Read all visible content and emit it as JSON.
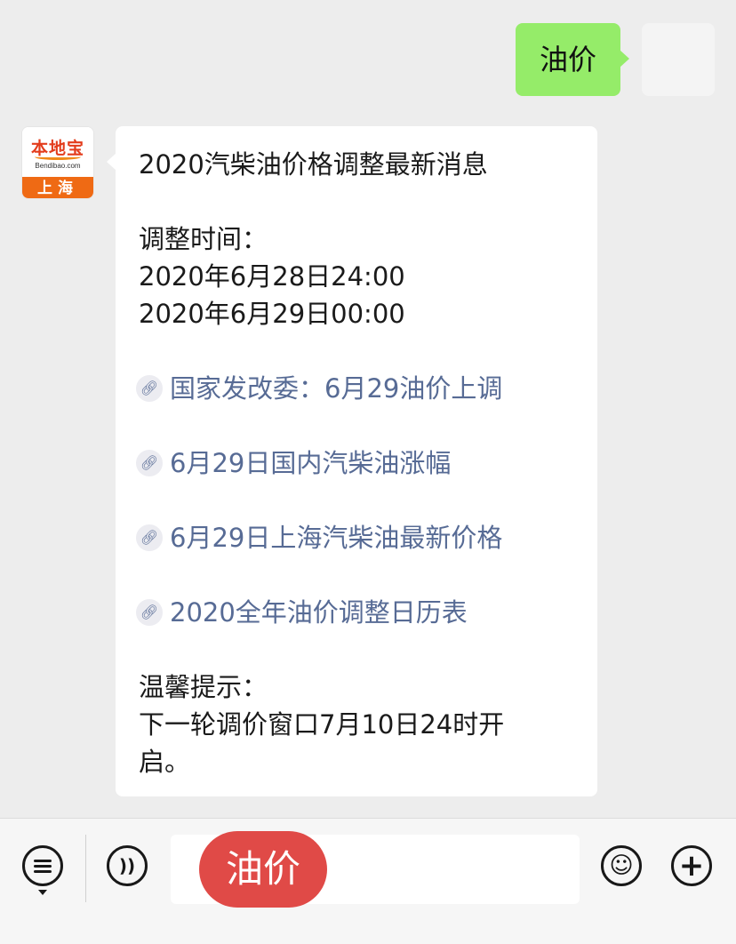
{
  "outgoing": {
    "text": "油价"
  },
  "avatar": {
    "brand": "本地宝",
    "url": "Bendibao.com",
    "city": "上海"
  },
  "message": {
    "title": "2020汽柴油价格调整最新消息",
    "time_label": "调整时间：",
    "time_1": "2020年6月28日24:00",
    "time_2": "2020年6月29日00:00",
    "links": [
      "国家发改委：6月29油价上调",
      "6月29日国内汽柴油涨幅",
      "6月29日上海汽柴油最新价格",
      "2020全年油价调整日历表"
    ],
    "tip_label": "温馨提示：",
    "tip_line1": "下一轮调价窗口7月10日24时开",
    "tip_line2": "启。"
  },
  "toolbar": {
    "input_value": "油价",
    "icons": [
      "menu-icon",
      "voice-icon",
      "emoji-icon",
      "plus-icon"
    ]
  },
  "colors": {
    "outgoing_bubble": "#95ec69",
    "link": "#576b95",
    "chat_bg": "#ededed",
    "input_pill": "#e04a47",
    "logo_orange": "#ef6a14"
  }
}
